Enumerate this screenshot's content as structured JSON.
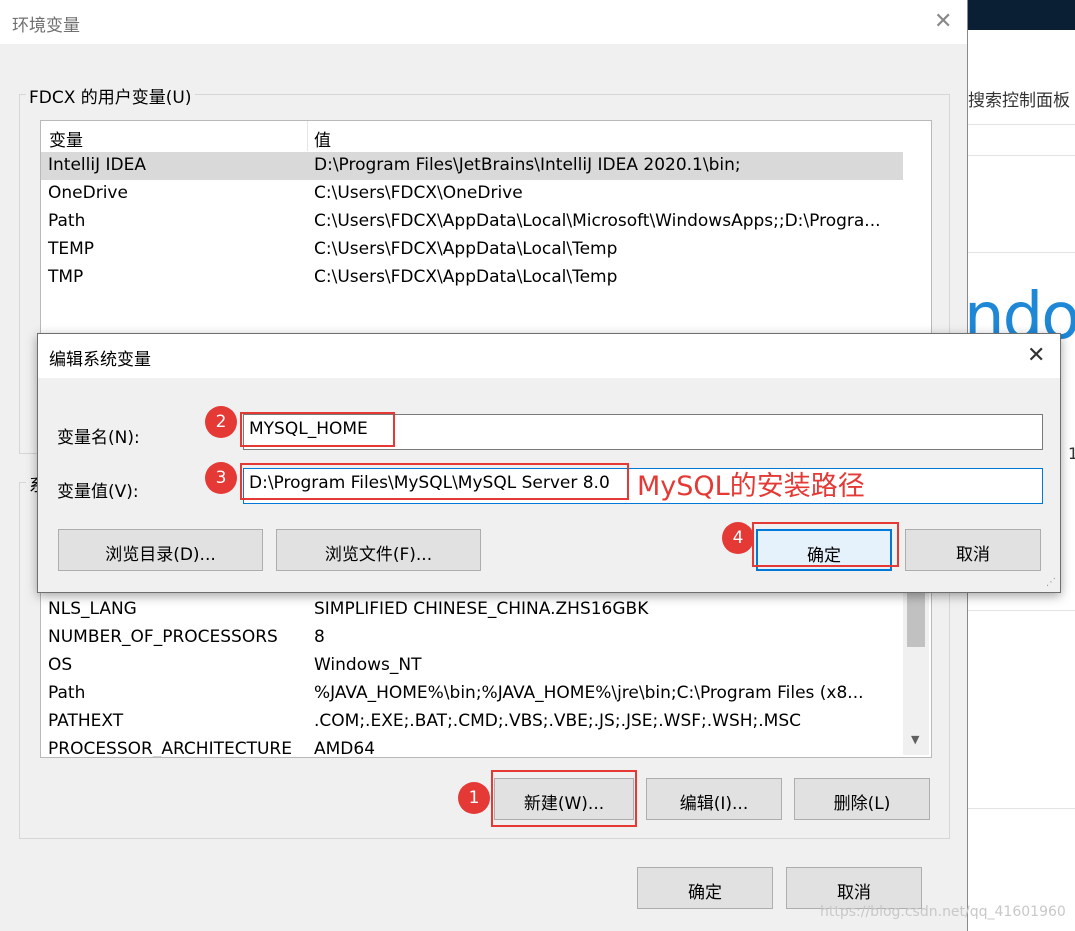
{
  "background_window": {
    "search_text": "搜索控制面板",
    "brand_text": "ndo",
    "side_digit": "1"
  },
  "env_dialog": {
    "title": "环境变量",
    "user_group_label": "FDCX 的用户变量(U)",
    "user_columns": [
      "变量",
      "值"
    ],
    "user_vars": [
      {
        "name": "IntelliJ IDEA",
        "value": "D:\\Program Files\\JetBrains\\IntelliJ IDEA 2020.1\\bin;"
      },
      {
        "name": "OneDrive",
        "value": "C:\\Users\\FDCX\\OneDrive"
      },
      {
        "name": "Path",
        "value": "C:\\Users\\FDCX\\AppData\\Local\\Microsoft\\WindowsApps;;D:\\Progra..."
      },
      {
        "name": "TEMP",
        "value": "C:\\Users\\FDCX\\AppData\\Local\\Temp"
      },
      {
        "name": "TMP",
        "value": "C:\\Users\\FDCX\\AppData\\Local\\Temp"
      }
    ],
    "system_group_label_partial": "系",
    "system_vars": [
      {
        "name": "NLS_LANG",
        "value": "SIMPLIFIED CHINESE_CHINA.ZHS16GBK"
      },
      {
        "name": "NUMBER_OF_PROCESSORS",
        "value": "8"
      },
      {
        "name": "OS",
        "value": "Windows_NT"
      },
      {
        "name": "Path",
        "value": "%JAVA_HOME%\\bin;%JAVA_HOME%\\jre\\bin;C:\\Program Files (x8..."
      },
      {
        "name": "PATHEXT",
        "value": ".COM;.EXE;.BAT;.CMD;.VBS;.VBE;.JS;.JSE;.WSF;.WSH;.MSC"
      },
      {
        "name": "PROCESSOR_ARCHITECTURE",
        "value": "AMD64"
      }
    ],
    "new_button": "新建(W)...",
    "edit_button": "编辑(I)...",
    "delete_button": "删除(L)",
    "ok_button": "确定",
    "cancel_button": "取消"
  },
  "edit_dialog": {
    "title": "编辑系统变量",
    "name_label": "变量名(N):",
    "name_value": "MYSQL_HOME",
    "value_label": "变量值(V):",
    "value_value": "D:\\Program Files\\MySQL\\MySQL Server 8.0",
    "browse_dir_button": "浏览目录(D)...",
    "browse_file_button": "浏览文件(F)...",
    "ok_button": "确定",
    "cancel_button": "取消"
  },
  "annotations": {
    "badges": [
      "1",
      "2",
      "3",
      "4"
    ],
    "note": "MySQL的安装路径",
    "color": "#e53935"
  },
  "watermark": "https://blog.csdn.net/qq_41601960"
}
